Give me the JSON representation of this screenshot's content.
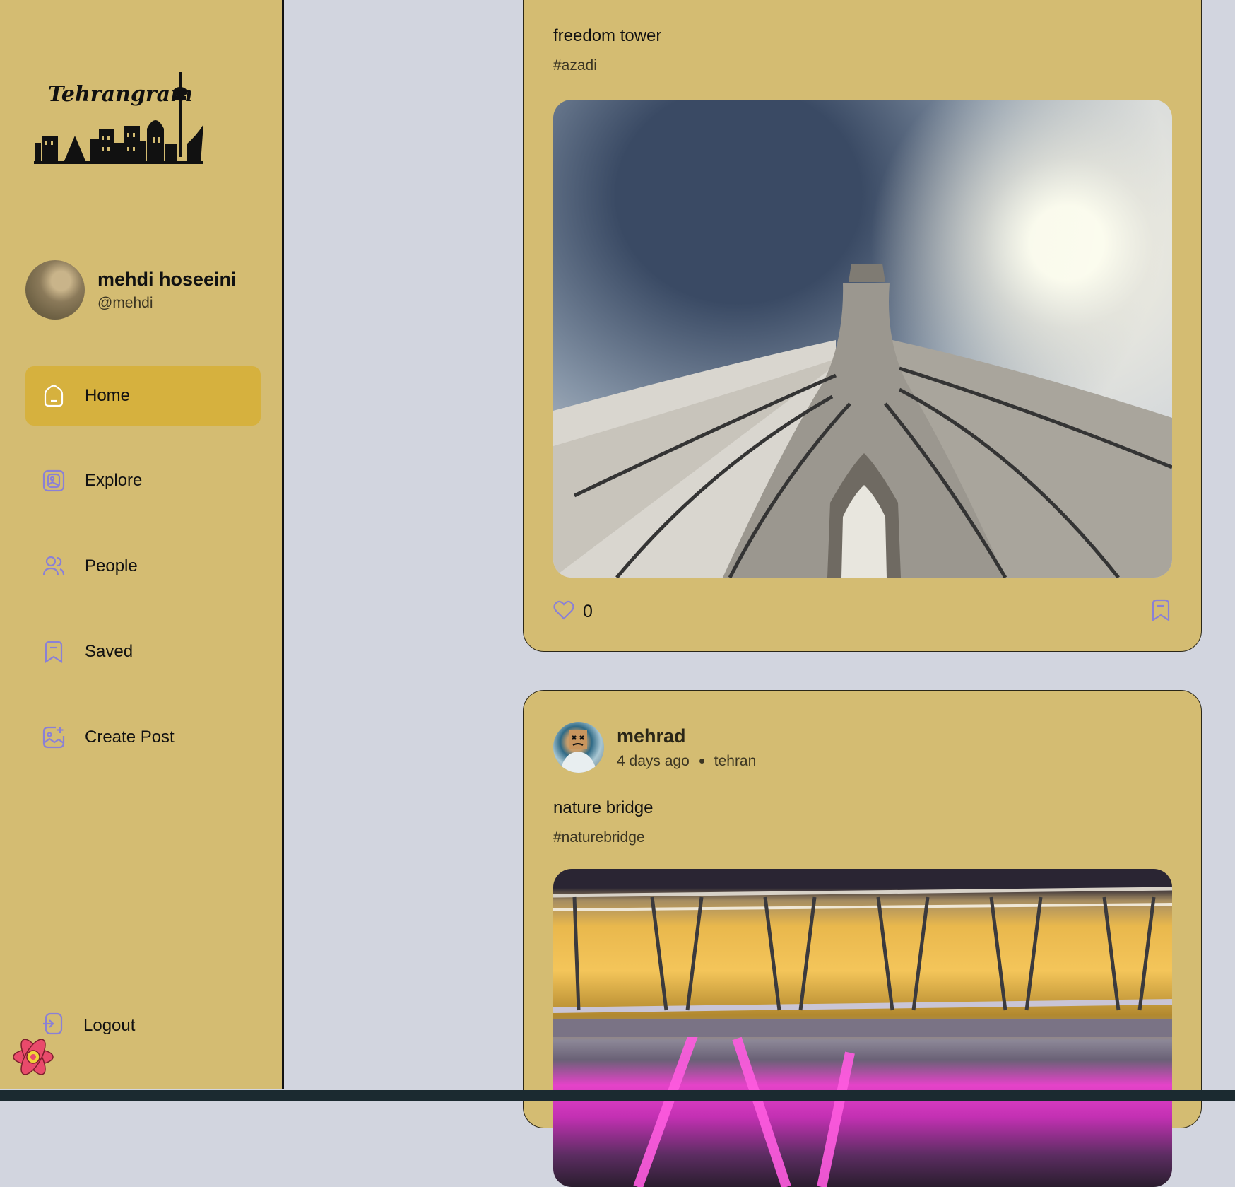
{
  "app": {
    "logo_text": "Tehrangram"
  },
  "profile": {
    "name": "mehdi hoseeini",
    "handle": "@mehdi"
  },
  "nav": {
    "items": [
      {
        "label": "Home",
        "icon": "home-icon",
        "active": true
      },
      {
        "label": "Explore",
        "icon": "gallery-icon",
        "active": false
      },
      {
        "label": "People",
        "icon": "people-icon",
        "active": false
      },
      {
        "label": "Saved",
        "icon": "bookmark-icon",
        "active": false
      },
      {
        "label": "Create Post",
        "icon": "add-image-icon",
        "active": false
      }
    ],
    "logout_label": "Logout"
  },
  "posts": [
    {
      "caption": "freedom tower",
      "tag": "#azadi",
      "image": "azadi-tower-photo",
      "likes": "0"
    },
    {
      "author": "mehrad",
      "time": "4 days ago",
      "location": "tehran",
      "caption": "nature bridge",
      "tag": "#naturebridge",
      "image": "nature-bridge-photo"
    }
  ],
  "colors": {
    "sidebar_bg": "#d4bc72",
    "active_nav": "#d6b13e",
    "page_bg": "#d2d5df",
    "icon_accent": "#8a80d6"
  }
}
